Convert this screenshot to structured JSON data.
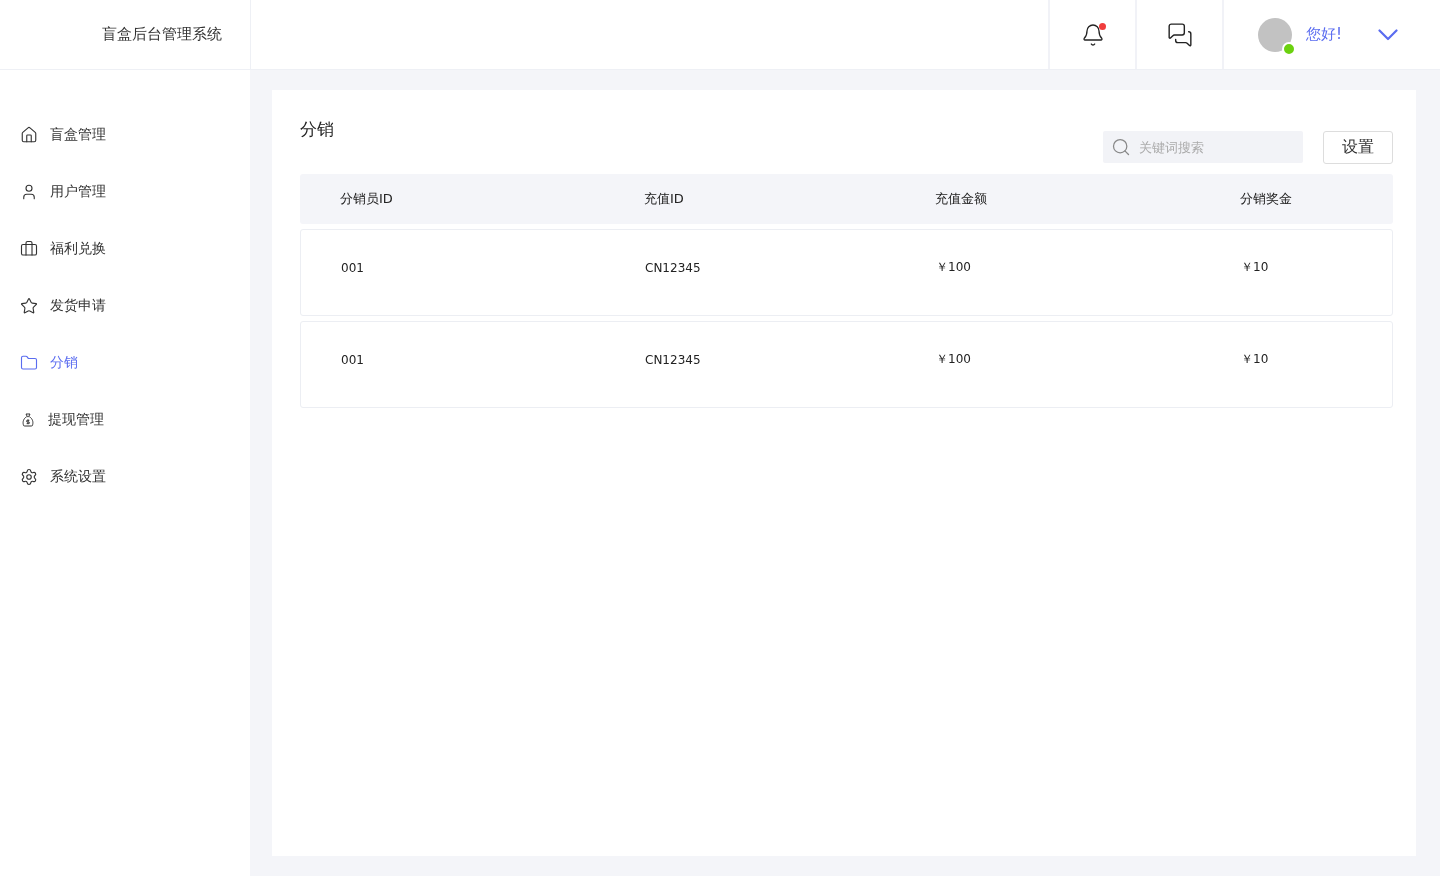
{
  "app_title": "盲盒后台管理系统",
  "header": {
    "notifications": {
      "unread": true
    },
    "greeting": "您好!"
  },
  "sidebar": {
    "items": [
      {
        "label": "盲盒管理",
        "kind": "home",
        "selected": false
      },
      {
        "label": "用户管理",
        "kind": "user",
        "selected": false
      },
      {
        "label": "福利兑换",
        "kind": "briefcase",
        "selected": false
      },
      {
        "label": "发货申请",
        "kind": "star",
        "selected": false
      },
      {
        "label": "分销",
        "kind": "folder",
        "selected": true
      },
      {
        "label": "提现管理",
        "kind": "moneybag",
        "selected": false
      },
      {
        "label": "系统设置",
        "kind": "settings",
        "selected": false
      }
    ]
  },
  "page": {
    "title": "分销",
    "search": {
      "placeholder": "关键词搜索"
    },
    "settings_button": "设置"
  },
  "table": {
    "columns": [
      "分销员ID",
      "充值ID",
      "充值金额",
      "分销奖金"
    ],
    "rows": [
      [
        "001",
        "CN12345",
        "￥100",
        "￥10"
      ],
      [
        "001",
        "CN12345",
        "￥100",
        "￥10"
      ]
    ]
  }
}
